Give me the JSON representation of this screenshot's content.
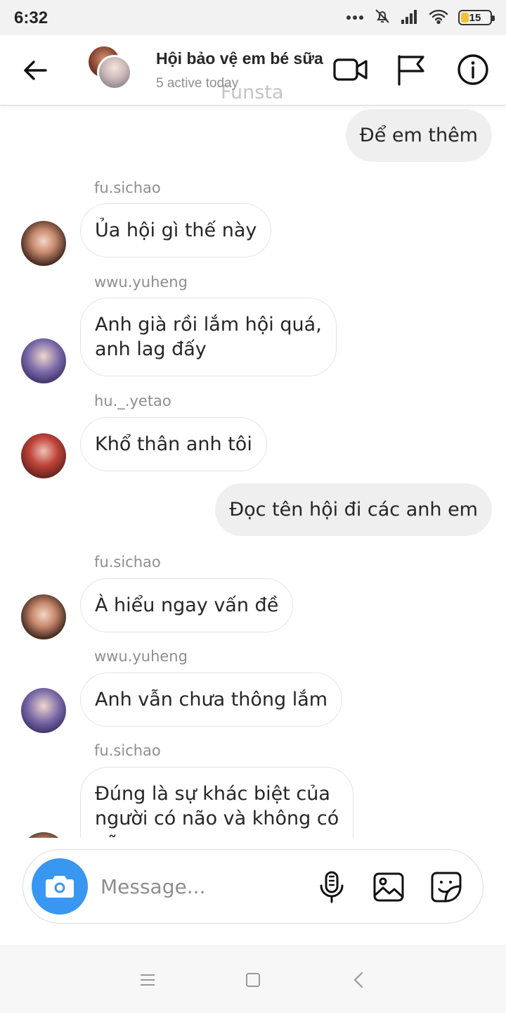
{
  "status_bar": {
    "time": "6:32",
    "battery": "15"
  },
  "header": {
    "title": "Hội bảo vệ em bé sữa",
    "subtitle": "5 active today",
    "watermark": "Funsta"
  },
  "messages": [
    {
      "kind": "out",
      "text": "Để em thêm"
    },
    {
      "kind": "in",
      "sender": "fu.sichao",
      "text": "Ủa hội gì thế này"
    },
    {
      "kind": "in",
      "sender": "wwu.yuheng",
      "line1": "Anh già rồi lắm hội quá,",
      "line2": "anh lag đấy"
    },
    {
      "kind": "in",
      "sender": "hu._.yetao",
      "text": "Khổ thân anh tôi"
    },
    {
      "kind": "out",
      "text": "Đọc tên hội đi các anh em"
    },
    {
      "kind": "in",
      "sender": "fu.sichao",
      "text": "À hiểu ngay vấn đề"
    },
    {
      "kind": "in",
      "sender": "wwu.yuheng",
      "text": "Anh vẫn chưa thông lắm"
    },
    {
      "kind": "in",
      "sender": "fu.sichao",
      "line1": "Đúng là sự khác biệt của",
      "line2": "người có não và không có",
      "line3": "não"
    }
  ],
  "composer": {
    "placeholder": "Message..."
  },
  "icons": {
    "back": "back-arrow-icon",
    "video": "video-camera-icon",
    "flag": "flag-icon",
    "info": "info-icon",
    "camera": "camera-icon",
    "mic": "microphone-icon",
    "gallery": "image-gallery-icon",
    "sticker": "sticker-icon"
  },
  "colors": {
    "accent": "#3897f0",
    "outgoing_bubble": "#efefef",
    "muted_text": "#8e8e8e"
  }
}
